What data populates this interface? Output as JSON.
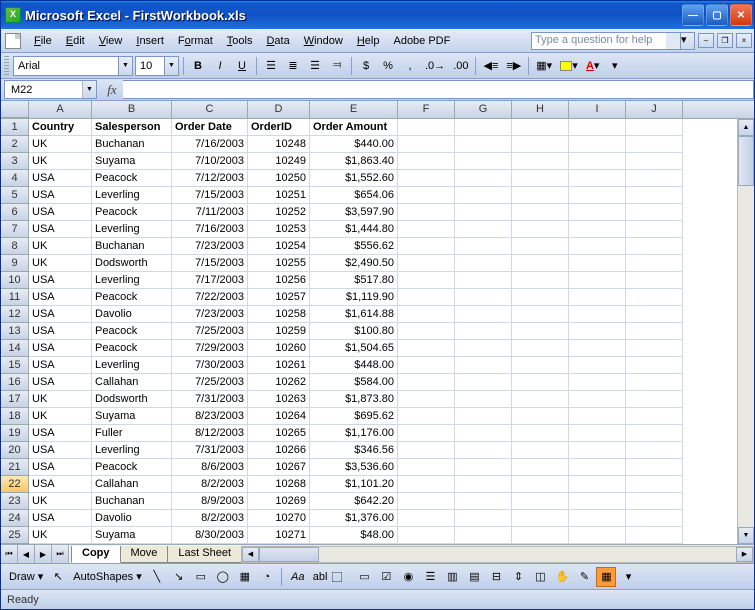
{
  "title": "Microsoft Excel - FirstWorkbook.xls",
  "menu": {
    "file": "File",
    "edit": "Edit",
    "view": "View",
    "insert": "Insert",
    "format": "Format",
    "tools": "Tools",
    "data": "Data",
    "window": "Window",
    "help": "Help",
    "adobe": "Adobe PDF"
  },
  "helpbox_placeholder": "Type a question for help",
  "toolbar": {
    "font": "Arial",
    "size": "10",
    "bold": "B",
    "italic": "I",
    "underline": "U",
    "currency": "$",
    "percent": "%",
    "comma": ",",
    "autoshapes": "AutoShapes",
    "draw": "Draw"
  },
  "namebox": "M22",
  "fx": "fx",
  "columns": [
    "A",
    "B",
    "C",
    "D",
    "E",
    "F",
    "G",
    "H",
    "I",
    "J"
  ],
  "headers": [
    "Country",
    "Salesperson",
    "Order Date",
    "OrderID",
    "Order Amount"
  ],
  "rows": [
    [
      "UK",
      "Buchanan",
      "7/16/2003",
      "10248",
      "$440.00"
    ],
    [
      "UK",
      "Suyama",
      "7/10/2003",
      "10249",
      "$1,863.40"
    ],
    [
      "USA",
      "Peacock",
      "7/12/2003",
      "10250",
      "$1,552.60"
    ],
    [
      "USA",
      "Leverling",
      "7/15/2003",
      "10251",
      "$654.06"
    ],
    [
      "USA",
      "Peacock",
      "7/11/2003",
      "10252",
      "$3,597.90"
    ],
    [
      "USA",
      "Leverling",
      "7/16/2003",
      "10253",
      "$1,444.80"
    ],
    [
      "UK",
      "Buchanan",
      "7/23/2003",
      "10254",
      "$556.62"
    ],
    [
      "UK",
      "Dodsworth",
      "7/15/2003",
      "10255",
      "$2,490.50"
    ],
    [
      "USA",
      "Leverling",
      "7/17/2003",
      "10256",
      "$517.80"
    ],
    [
      "USA",
      "Peacock",
      "7/22/2003",
      "10257",
      "$1,119.90"
    ],
    [
      "USA",
      "Davolio",
      "7/23/2003",
      "10258",
      "$1,614.88"
    ],
    [
      "USA",
      "Peacock",
      "7/25/2003",
      "10259",
      "$100.80"
    ],
    [
      "USA",
      "Peacock",
      "7/29/2003",
      "10260",
      "$1,504.65"
    ],
    [
      "USA",
      "Leverling",
      "7/30/2003",
      "10261",
      "$448.00"
    ],
    [
      "USA",
      "Callahan",
      "7/25/2003",
      "10262",
      "$584.00"
    ],
    [
      "UK",
      "Dodsworth",
      "7/31/2003",
      "10263",
      "$1,873.80"
    ],
    [
      "UK",
      "Suyama",
      "8/23/2003",
      "10264",
      "$695.62"
    ],
    [
      "USA",
      "Fuller",
      "8/12/2003",
      "10265",
      "$1,176.00"
    ],
    [
      "USA",
      "Leverling",
      "7/31/2003",
      "10266",
      "$346.56"
    ],
    [
      "USA",
      "Peacock",
      "8/6/2003",
      "10267",
      "$3,536.60"
    ],
    [
      "USA",
      "Callahan",
      "8/2/2003",
      "10268",
      "$1,101.20"
    ],
    [
      "UK",
      "Buchanan",
      "8/9/2003",
      "10269",
      "$642.20"
    ],
    [
      "USA",
      "Davolio",
      "8/2/2003",
      "10270",
      "$1,376.00"
    ],
    [
      "UK",
      "Suyama",
      "8/30/2003",
      "10271",
      "$48.00"
    ]
  ],
  "selected_row": 22,
  "tabs": {
    "active": "Copy",
    "others": [
      "Move",
      "Last Sheet"
    ]
  },
  "drawbar": {
    "label_aa": "Aa",
    "label_abl": "abl"
  },
  "status": "Ready"
}
